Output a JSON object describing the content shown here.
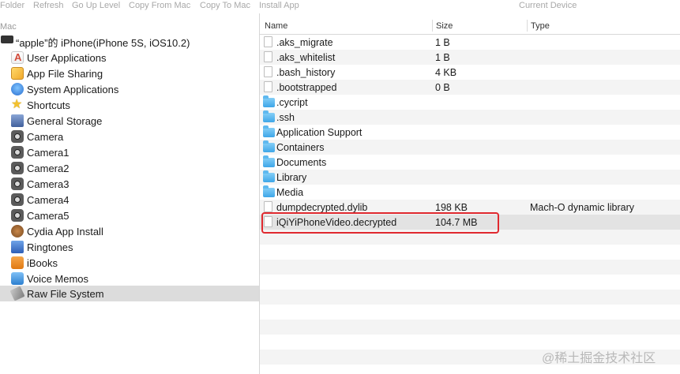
{
  "toolbar": {
    "buttons": [
      "Folder",
      "Refresh",
      "Go Up Level",
      "Copy From Mac",
      "Copy To Mac",
      "Install App"
    ],
    "device_label": "Current Device"
  },
  "sidebar": {
    "mac_label": "Mac",
    "device": "“apple”的 iPhone(iPhone 5S, iOS10.2)",
    "items": [
      {
        "label": "User Applications",
        "icon": "user-applications-icon"
      },
      {
        "label": "App File Sharing",
        "icon": "app-file-sharing-icon"
      },
      {
        "label": "System Applications",
        "icon": "system-applications-icon"
      },
      {
        "label": "Shortcuts",
        "icon": "star-icon"
      },
      {
        "label": "General Storage",
        "icon": "storage-icon"
      },
      {
        "label": "Camera",
        "icon": "camera-icon"
      },
      {
        "label": "Camera1",
        "icon": "camera-icon"
      },
      {
        "label": "Camera2",
        "icon": "camera-icon"
      },
      {
        "label": "Camera3",
        "icon": "camera-icon"
      },
      {
        "label": "Camera4",
        "icon": "camera-icon"
      },
      {
        "label": "Camera5",
        "icon": "camera-icon"
      },
      {
        "label": "Cydia App Install",
        "icon": "cydia-icon"
      },
      {
        "label": "Ringtones",
        "icon": "ringtones-icon"
      },
      {
        "label": "iBooks",
        "icon": "ibooks-icon"
      },
      {
        "label": "Voice Memos",
        "icon": "voice-memos-icon"
      },
      {
        "label": "Raw File System",
        "icon": "raw-file-system-icon",
        "selected": true
      }
    ]
  },
  "file_list": {
    "columns": {
      "name": "Name",
      "size": "Size",
      "type": "Type"
    },
    "rows": [
      {
        "name": ".aks_migrate",
        "size": "1 B",
        "type": "",
        "kind": "file"
      },
      {
        "name": ".aks_whitelist",
        "size": "1 B",
        "type": "",
        "kind": "file"
      },
      {
        "name": ".bash_history",
        "size": "4 KB",
        "type": "",
        "kind": "file"
      },
      {
        "name": ".bootstrapped",
        "size": "0 B",
        "type": "",
        "kind": "file"
      },
      {
        "name": ".cycript",
        "size": "",
        "type": "",
        "kind": "folder"
      },
      {
        "name": ".ssh",
        "size": "",
        "type": "",
        "kind": "folder"
      },
      {
        "name": "Application Support",
        "size": "",
        "type": "",
        "kind": "folder"
      },
      {
        "name": "Containers",
        "size": "",
        "type": "",
        "kind": "folder"
      },
      {
        "name": "Documents",
        "size": "",
        "type": "",
        "kind": "folder"
      },
      {
        "name": "Library",
        "size": "",
        "type": "",
        "kind": "folder"
      },
      {
        "name": "Media",
        "size": "",
        "type": "",
        "kind": "folder"
      },
      {
        "name": "dumpdecrypted.dylib",
        "size": "198 KB",
        "type": "Mach-O dynamic library",
        "kind": "file"
      },
      {
        "name": "iQiYiPhoneVideo.decrypted",
        "size": "104.7 MB",
        "type": "",
        "kind": "file",
        "highlighted": true
      }
    ]
  },
  "watermark": "@稀土掘金技术社区",
  "colors": {
    "highlight_border": "#e0292f",
    "selected_row": "#dcdcdc"
  }
}
